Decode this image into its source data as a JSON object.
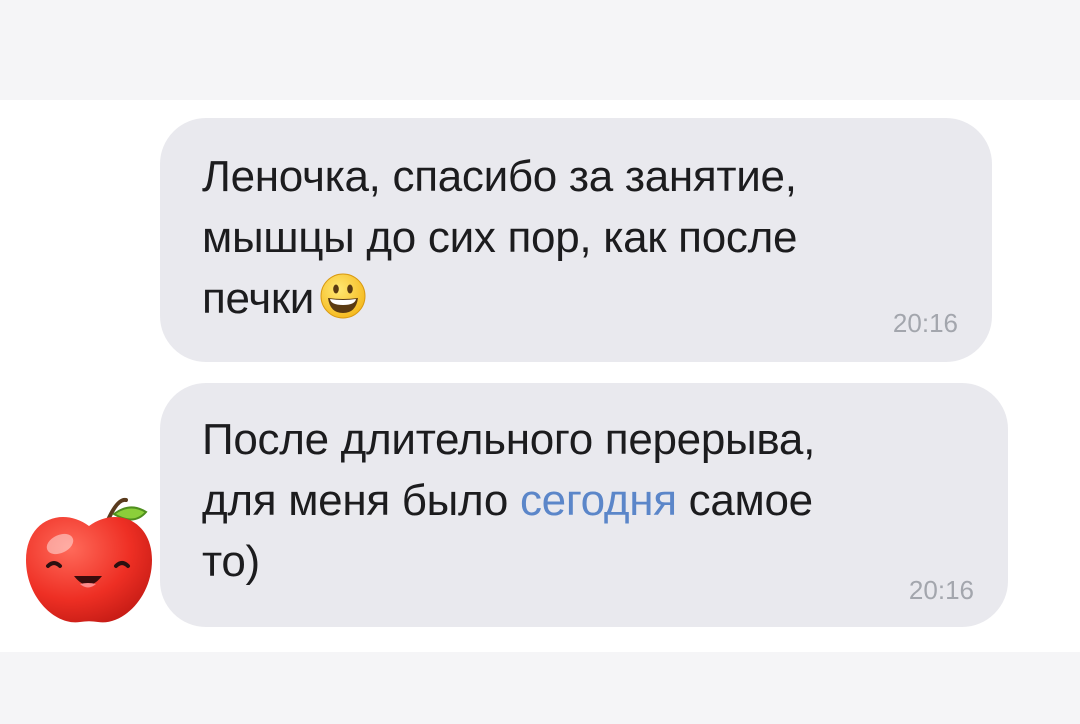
{
  "messages": [
    {
      "lines": [
        "Леночка, спасибо за занятие,",
        "мышцы до сих пор, как после",
        "печки"
      ],
      "emoji": "grinning-face-emoji",
      "time": "20:16"
    },
    {
      "lines": [
        "После длительного перерыва,"
      ],
      "line2_before": "для меня было ",
      "line2_link": "сегодня",
      "line2_after": " самое",
      "line3": "то)",
      "time": "20:16"
    }
  ],
  "sender_avatar": "smiling-apple-sticker",
  "colors": {
    "bubble": "#e9e9ee",
    "link": "#5b86c9",
    "timestamp": "#a3a6ad"
  }
}
